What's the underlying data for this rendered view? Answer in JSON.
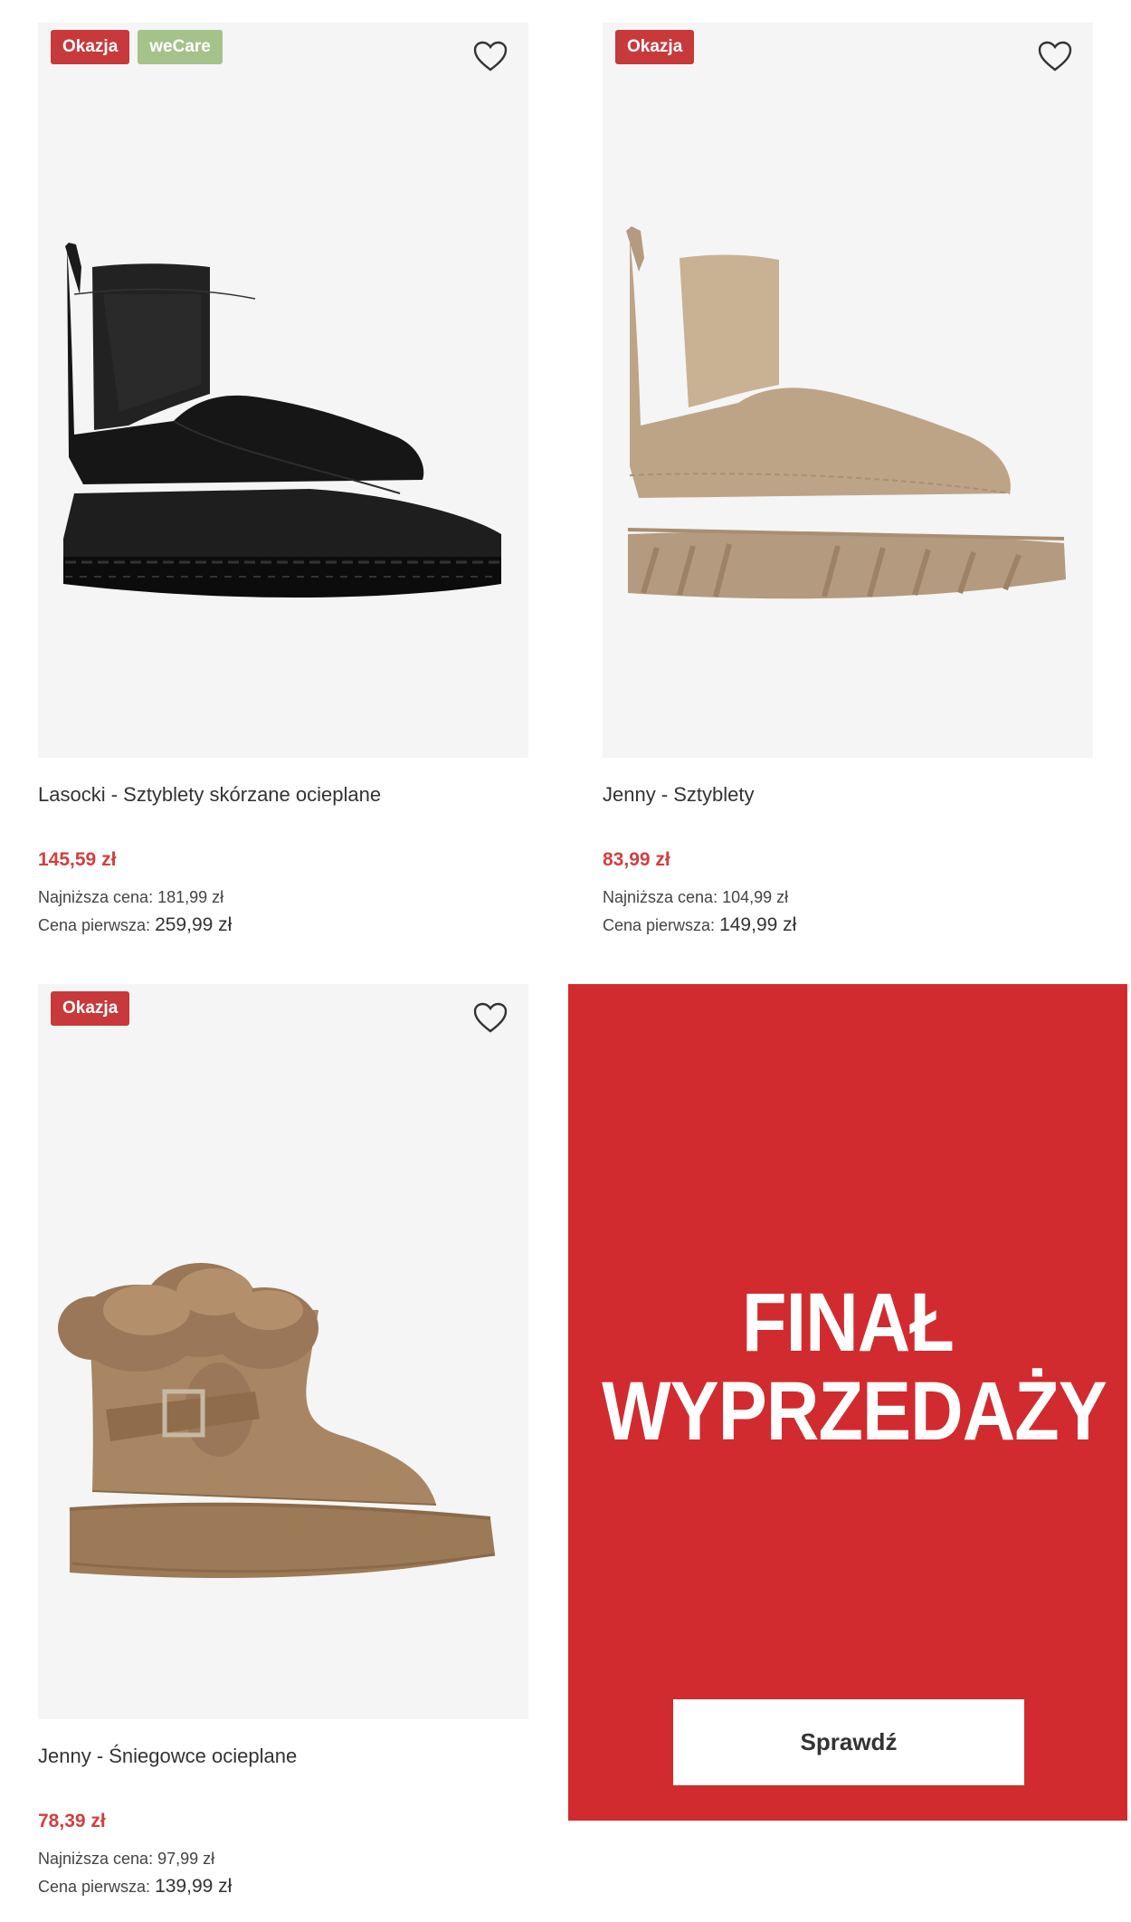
{
  "products": [
    {
      "badges": [
        "Okazja",
        "weCare"
      ],
      "title": "Lasocki - Sztyblety skórzane ocieplane",
      "price": "145,59 zł",
      "lowest_label": "Najniższa cena:",
      "lowest_value": "181,99 zł",
      "first_label": "Cena pierwsza:",
      "first_value": "259,99 zł"
    },
    {
      "badges": [
        "Okazja"
      ],
      "title": "Jenny - Sztyblety",
      "price": "83,99 zł",
      "lowest_label": "Najniższa cena:",
      "lowest_value": "104,99 zł",
      "first_label": "Cena pierwsza:",
      "first_value": "149,99 zł"
    },
    {
      "badges": [
        "Okazja"
      ],
      "title": "Jenny - Śniegowce ocieplane",
      "price": "78,39 zł",
      "lowest_label": "Najniższa cena:",
      "lowest_value": "97,99 zł",
      "first_label": "Cena pierwsza:",
      "first_value": "139,99 zł"
    }
  ],
  "promo": {
    "line1": "FINAŁ",
    "line2": "WYPRZEDAŻY",
    "button_label": "Sprawdź"
  },
  "colors": {
    "badge_okazja": "#c8393b",
    "badge_wecare": "#a5c28a",
    "price": "#d0403f",
    "promo_bg": "#d12b2f"
  }
}
